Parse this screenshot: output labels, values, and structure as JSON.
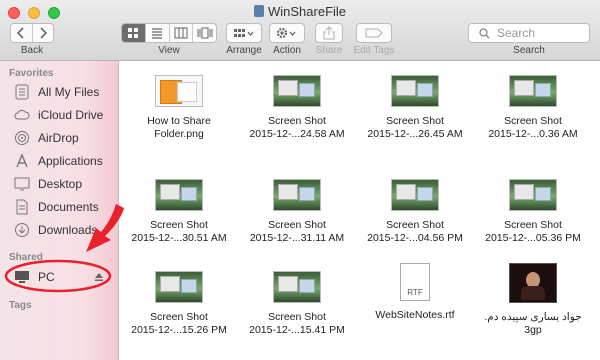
{
  "window": {
    "title": "WinShareFile"
  },
  "toolbar": {
    "back_label": "Back",
    "view_label": "View",
    "arrange_label": "Arrange",
    "action_label": "Action",
    "share_label": "Share",
    "edit_tags_label": "Edit Tags",
    "search_placeholder": "Search",
    "search_label": "Search"
  },
  "sidebar": {
    "favorites_heading": "Favorites",
    "favorites": [
      {
        "label": "All My Files",
        "icon": "all-files-icon"
      },
      {
        "label": "iCloud Drive",
        "icon": "cloud-icon"
      },
      {
        "label": "AirDrop",
        "icon": "airdrop-icon"
      },
      {
        "label": "Applications",
        "icon": "applications-icon"
      },
      {
        "label": "Desktop",
        "icon": "desktop-icon"
      },
      {
        "label": "Documents",
        "icon": "documents-icon"
      },
      {
        "label": "Downloads",
        "icon": "downloads-icon"
      }
    ],
    "shared_heading": "Shared",
    "shared": [
      {
        "label": "PC",
        "icon": "computer-icon"
      }
    ],
    "tags_heading": "Tags"
  },
  "files": [
    {
      "line1": "How to Share",
      "line2": "Folder.png"
    },
    {
      "line1": "Screen Shot",
      "line2": "2015-12-...24.58 AM"
    },
    {
      "line1": "Screen Shot",
      "line2": "2015-12-...26.45 AM"
    },
    {
      "line1": "Screen Shot",
      "line2": "2015-12-...0.36 AM"
    },
    {
      "line1": "Screen Shot",
      "line2": "2015-12-...30.51 AM"
    },
    {
      "line1": "Screen Shot",
      "line2": "2015-12-...31.11 AM"
    },
    {
      "line1": "Screen Shot",
      "line2": "2015-12-...04.56 PM"
    },
    {
      "line1": "Screen Shot",
      "line2": "2015-12-...05.36 PM"
    },
    {
      "line1": "Screen Shot",
      "line2": "2015-12-...15.26 PM"
    },
    {
      "line1": "Screen Shot",
      "line2": "2015-12-...15.41 PM"
    },
    {
      "line1": "WebSiteNotes.rtf",
      "line2": "",
      "badge": "RTF"
    },
    {
      "line1": "جواد يسارى سپيده دم.",
      "line2": "3gp"
    }
  ],
  "colors": {
    "callout": "#e8212a",
    "sidebar_tint": "#f9dfe6"
  }
}
